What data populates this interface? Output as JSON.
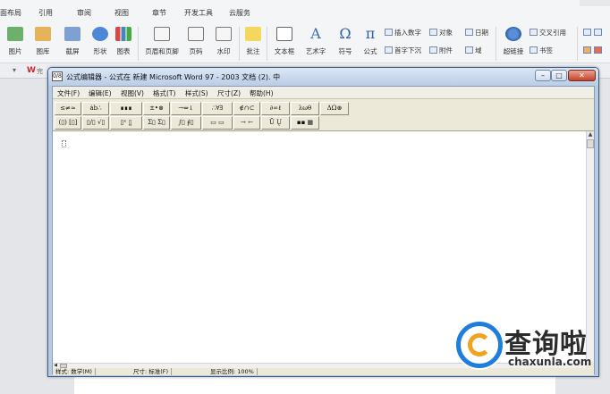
{
  "ribbon": {
    "tabs": [
      "面布局",
      "引用",
      "审阅",
      "视图",
      "章节",
      "开发工具",
      "云服务"
    ],
    "tools_large": [
      "图片",
      "图库",
      "截屏",
      "形状",
      "图表",
      "页眉和页脚",
      "页码",
      "水印",
      "批注",
      "文本框",
      "艺术字",
      "符号",
      "公式",
      "超链接"
    ],
    "tools_small": [
      "插入数字",
      "首字下沉",
      "对象",
      "附件",
      "日期",
      "域",
      "交叉引用",
      "书签"
    ],
    "doc_logo": "W",
    "doc_name": "完"
  },
  "window": {
    "title": "公式编辑器 - 公式在 新建 Microsoft Word 97 - 2003 文档 (2). 中",
    "app_icon": "0/8",
    "controls": {
      "minimize": "–",
      "maximize": "□",
      "close": "✕"
    }
  },
  "menu": [
    "文件(F)",
    "编辑(E)",
    "视图(V)",
    "格式(T)",
    "样式(S)",
    "尺寸(Z)",
    "帮助(H)"
  ],
  "palette": {
    "row1": [
      "≤≠≈",
      "ȧb∴",
      "∎∎∎",
      "±•⊗",
      "→⇔↓",
      "∴∀∃",
      "∉∩⊂",
      "∂∞ℓ",
      "λωθ",
      "ΔΩ⊛"
    ],
    "row2": [
      "(▯) [▯]",
      "▯/▯ √▯",
      "▯ˣ ▯̲",
      "Σ▯ Σ▯",
      "∫▯ ∮▯",
      "▭ ▭",
      "→ ←",
      "Ū Ų",
      "▪▪ ▦"
    ]
  },
  "status": {
    "style": "样式: 数学(M)",
    "size": "尺寸: 标准(F)",
    "zoom": "显示比例: 100%"
  },
  "watermark": {
    "name": "查询啦",
    "url": "chaxunla.com"
  }
}
